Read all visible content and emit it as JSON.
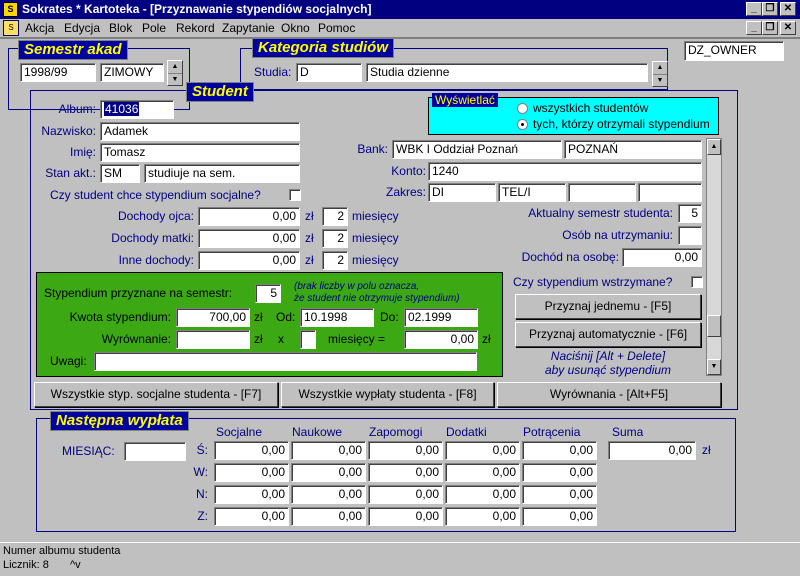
{
  "window": {
    "title": "Sokrates * Kartoteka - [Przyznawanie stypendiów socjalnych]",
    "minimize": "_",
    "restore": "❐",
    "close": "✕",
    "mdi_icon": "app-icon"
  },
  "menu": [
    "Akcja",
    "Edycja",
    "Blok",
    "Pole",
    "Rekord",
    "Zapytanie",
    "Okno",
    "Pomoc"
  ],
  "owner": "DZ_OWNER",
  "semestr": {
    "caption": "Semestr akad",
    "year": "1998/99",
    "season": "ZIMOWY"
  },
  "kategoria": {
    "caption": "Kategoria studiów",
    "label": "Studia:",
    "code": "D",
    "name": "Studia dzienne"
  },
  "student": {
    "caption": "Student",
    "album_label": "Album:",
    "album": "41036",
    "nazwisko_label": "Nazwisko:",
    "nazwisko": "Adamek",
    "imie_label": "Imię:",
    "imie": "Tomasz",
    "stan_label": "Stan akt.:",
    "stan_code": "SM",
    "stan_desc": "studiuje na sem.",
    "chce_label": "Czy student chce stypendium socjalne?",
    "dochody_ojca_label": "Dochody ojca:",
    "dochody_ojca": "0,00",
    "dochody_ojca_m": "2",
    "dochody_matki_label": "Dochody matki:",
    "dochody_matki": "0,00",
    "dochody_matki_m": "2",
    "inne_label": "Inne dochody:",
    "inne": "0,00",
    "inne_m": "2",
    "zl": "zł",
    "miesiecy": "miesięcy"
  },
  "wyswietlac": {
    "caption": "Wyświetlać",
    "opt1": "wszystkich studentów",
    "opt2": "tych, którzy otrzymali stypendium",
    "selected": "opt2"
  },
  "bank": {
    "bank_label": "Bank:",
    "bank_name": "WBK I Oddział Poznań",
    "bank_city": "POZNAŃ",
    "konto_label": "Konto:",
    "konto": "1240",
    "zakres_label": "Zakres:",
    "zakres1": "DI",
    "zakres2": "TEL/I",
    "zakres3": "",
    "zakres4": "",
    "zakres5": ""
  },
  "right": {
    "semestr_label": "Aktualny semestr studenta:",
    "semestr": "5",
    "osob_label": "Osób na utrzymaniu:",
    "osob": "",
    "dochod_label": "Dochód na osobę:",
    "dochod": "0,00",
    "wstrzymane_label": "Czy stypendium wstrzymane?",
    "btn_jednemu": "Przyznaj jednemu - [F5]",
    "btn_auto": "Przyznaj automatycznie - [F6]",
    "hint1": "Naciśnij [Alt + Delete]",
    "hint2": "aby usunąć stypendium"
  },
  "stypendium": {
    "sem_label": "Stypendium przyznane na semestr:",
    "sem": "5",
    "note1": "(brak liczby w polu oznacza,",
    "note2": "że student nie otrzymuje stypendium)",
    "kwota_label": "Kwota stypendium:",
    "kwota": "700,00",
    "zl": "zł",
    "od_label": "Od:",
    "od": "10.1998",
    "do_label": "Do:",
    "do": "02.1999",
    "wyr_label": "Wyrównanie:",
    "wyr": "",
    "x": "x",
    "wyr_m": "",
    "miesiecy_eq": "miesięcy =",
    "wyr_total": "0,00",
    "uwagi_label": "Uwagi:",
    "uwagi": ""
  },
  "buttons": {
    "all_styp": "Wszystkie styp. socjalne studenta - [F7]",
    "all_wyplaty": "Wszystkie wypłaty studenta - [F8]",
    "wyrownania": "Wyrównania - [Alt+F5]"
  },
  "nastepna": {
    "caption": "Następna wypłata",
    "miesiac_label": "MIESIĄC:",
    "miesiac": "",
    "headers": [
      "Socjalne",
      "Naukowe",
      "Zapomogi",
      "Dodatki",
      "Potrącenia",
      "Suma"
    ],
    "rows": [
      {
        "label": "Ś:",
        "values": [
          "0,00",
          "0,00",
          "0,00",
          "0,00",
          "0,00"
        ]
      },
      {
        "label": "W:",
        "values": [
          "0,00",
          "0,00",
          "0,00",
          "0,00",
          "0,00"
        ]
      },
      {
        "label": "N:",
        "values": [
          "0,00",
          "0,00",
          "0,00",
          "0,00",
          "0,00"
        ]
      },
      {
        "label": "Z:",
        "values": [
          "0,00",
          "0,00",
          "0,00",
          "0,00",
          "0,00"
        ]
      }
    ],
    "suma": "0,00",
    "zl": "zł"
  },
  "status": {
    "message": "Numer albumu studenta",
    "licznik": "Licznik: 8",
    "mode": "^v"
  }
}
